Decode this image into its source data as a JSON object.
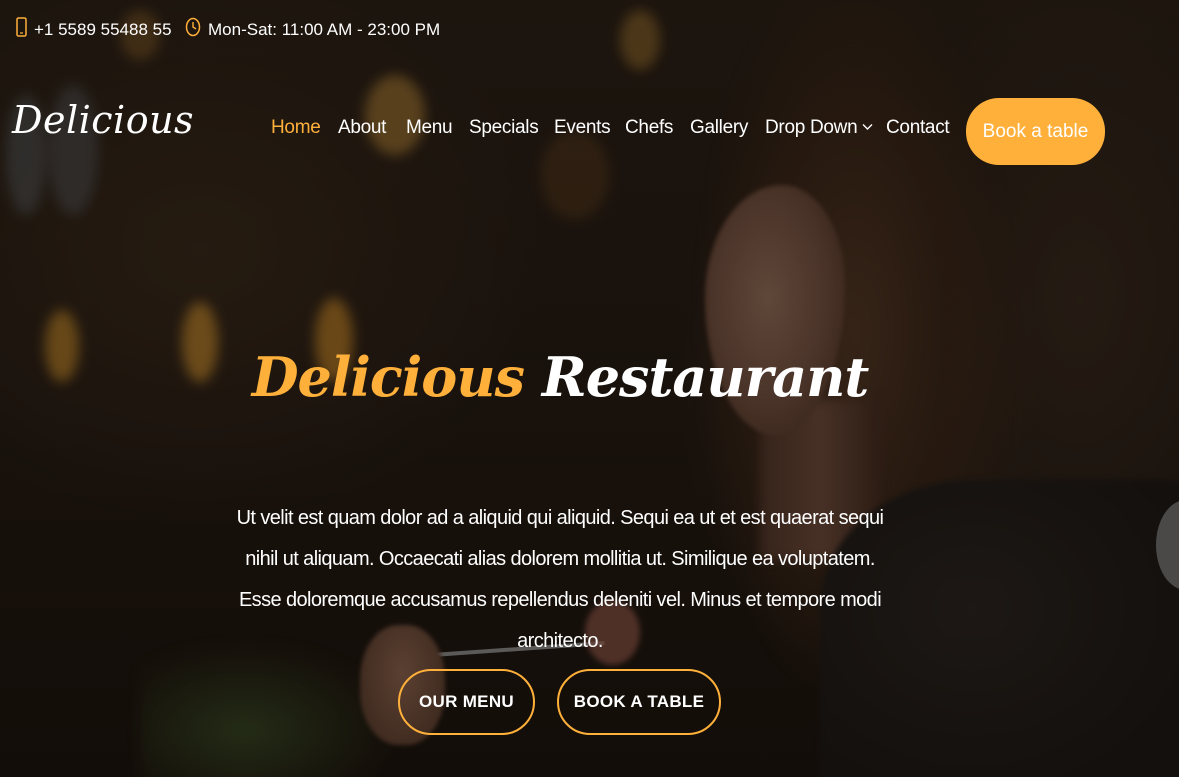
{
  "topbar": {
    "phone": "+1 5589 55488 55",
    "phone_icon": "phone-icon",
    "hours": "Mon-Sat: 11:00 AM - 23:00 PM",
    "hours_icon": "clock-icon"
  },
  "header": {
    "logo": "Delicious",
    "nav": [
      {
        "label": "Home",
        "active": true
      },
      {
        "label": "About"
      },
      {
        "label": "Menu"
      },
      {
        "label": "Specials"
      },
      {
        "label": "Events"
      },
      {
        "label": "Chefs"
      },
      {
        "label": "Gallery"
      },
      {
        "label": "Drop Down",
        "icon": "chevron-down-icon"
      },
      {
        "label": "Contact"
      }
    ],
    "book_button": "Book a table"
  },
  "hero": {
    "title_part1": "Delicious",
    "title_part2": "Restaurant",
    "text": "Ut velit est quam dolor ad a aliquid qui aliquid. Sequi ea ut et est quaerat sequi nihil ut aliquam. Occaecati alias dolorem mollitia ut. Similique ea voluptatem. Esse doloremque accusamus repellendus deleniti vel. Minus et tempore modi architecto.",
    "btn_menu": "OUR MENU",
    "btn_book": "BOOK A TABLE"
  },
  "colors": {
    "accent": "#ffb03b",
    "text": "#ffffff"
  }
}
